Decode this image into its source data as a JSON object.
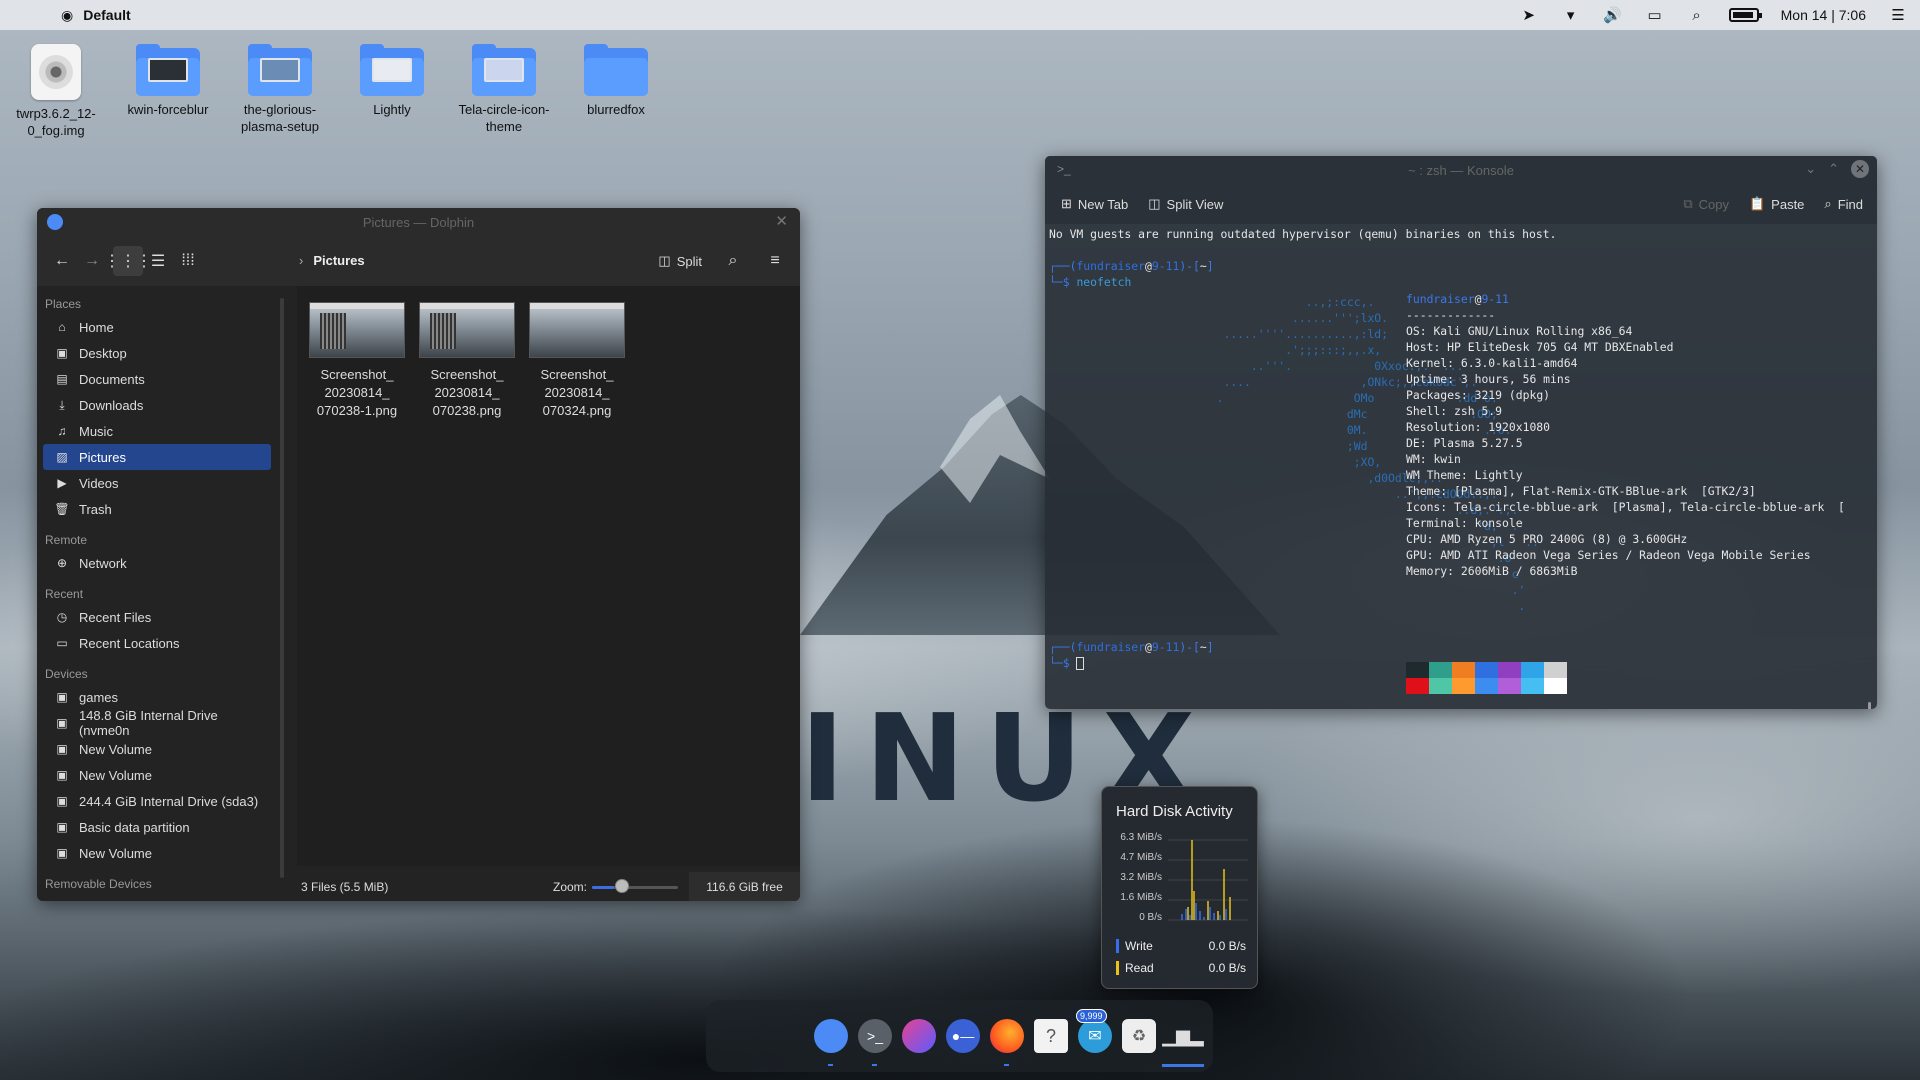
{
  "topbar": {
    "app": "Default",
    "clock": "Mon 14 | 7:06"
  },
  "desktop_icons": [
    {
      "label": "twrp3.6.2_12-0_fog.img",
      "type": "disc"
    },
    {
      "label": "kwin-forceblur",
      "type": "folder"
    },
    {
      "label": "the-glorious-plasma-setup",
      "type": "folder"
    },
    {
      "label": "Lightly",
      "type": "folder"
    },
    {
      "label": "Tela-circle-icon-theme",
      "type": "folder"
    },
    {
      "label": "blurredfox",
      "type": "folder"
    }
  ],
  "wallpaper_text": "INUX",
  "dolphin": {
    "title": "Pictures — Dolphin",
    "crumb": "Pictures",
    "split_label": "Split",
    "sidebar": {
      "places_head": "Places",
      "places": [
        "Home",
        "Desktop",
        "Documents",
        "Downloads",
        "Music",
        "Pictures",
        "Videos",
        "Trash"
      ],
      "remote_head": "Remote",
      "remote": [
        "Network"
      ],
      "recent_head": "Recent",
      "recent": [
        "Recent Files",
        "Recent Locations"
      ],
      "devices_head": "Devices",
      "devices": [
        "games",
        "148.8 GiB Internal Drive (nvme0n",
        "New Volume",
        "New Volume",
        "244.4 GiB Internal Drive (sda3)",
        "Basic data partition",
        "New Volume"
      ],
      "removable_head": "Removable Devices"
    },
    "files": [
      {
        "l1": "Screenshot_",
        "l2": "20230814_",
        "l3": "070238-1.png"
      },
      {
        "l1": "Screenshot_",
        "l2": "20230814_",
        "l3": "070238.png"
      },
      {
        "l1": "Screenshot_",
        "l2": "20230814_",
        "l3": "070324.png"
      }
    ],
    "status": "3 Files (5.5 MiB)",
    "zoom_label": "Zoom:",
    "zoom_level": 0.25,
    "free": "116.6 GiB free"
  },
  "konsole": {
    "title": "~ : zsh — Konsole",
    "new_tab": "New Tab",
    "split_view": "Split View",
    "copy": "Copy",
    "paste": "Paste",
    "find": "Find",
    "line1": "No VM guests are running outdated hypervisor (qemu) binaries on this host.",
    "user": "fundraiser",
    "host": "9-11",
    "path": "~",
    "command": "neofetch",
    "separator": "-------------",
    "info": [
      {
        "k": "OS",
        "v": "Kali GNU/Linux Rolling x86_64"
      },
      {
        "k": "Host",
        "v": "HP EliteDesk 705 G4 MT DBXEnabled"
      },
      {
        "k": "Kernel",
        "v": "6.3.0-kali1-amd64"
      },
      {
        "k": "Uptime",
        "v": "3 hours, 56 mins"
      },
      {
        "k": "Packages",
        "v": "3219 (dpkg)"
      },
      {
        "k": "Shell",
        "v": "zsh 5.9"
      },
      {
        "k": "Resolution",
        "v": "1920x1080"
      },
      {
        "k": "DE",
        "v": "Plasma 5.27.5"
      },
      {
        "k": "WM",
        "v": "kwin"
      },
      {
        "k": "WM Theme",
        "v": "Lightly"
      },
      {
        "k": "Theme",
        "v": "[Plasma], Flat-Remix-GTK-BBlue-ark  [GTK2/3]"
      },
      {
        "k": "Icons",
        "v": "Tela-circle-bblue-ark  [Plasma], Tela-circle-bblue-ark  ["
      },
      {
        "k": "Terminal",
        "v": "konsole"
      },
      {
        "k": "CPU",
        "v": "AMD Ryzen 5 PRO 2400G (8) @ 3.600GHz"
      },
      {
        "k": "GPU",
        "v": "AMD ATI Radeon Vega Series / Radeon Vega Mobile Series"
      },
      {
        "k": "Memory",
        "v": "2606MiB / 6863MiB"
      }
    ],
    "swatches": [
      "#1e2a2e",
      "#e0101a",
      "#2f9e8a",
      "#4fc6a5",
      "#ef7d22",
      "#ff9a2e",
      "#2f6fe0",
      "#3d8cf0",
      "#8f3fbf",
      "#b05fd8",
      "#2fa4e8",
      "#45bff2",
      "#d0d0d0",
      "#ffffff"
    ]
  },
  "hdd": {
    "title": "Hard Disk Activity",
    "yticks": [
      "6.3 MiB/s",
      "4.7 MiB/s",
      "3.2 MiB/s",
      "1.6 MiB/s",
      "0 B/s"
    ],
    "write_label": "Write",
    "write_value": "0.0 B/s",
    "write_color": "#3a6ee8",
    "read_label": "Read",
    "read_value": "0.0 B/s",
    "read_color": "#e8c21a"
  },
  "dock": {
    "badge": "9,999",
    "items": [
      "apple-icon",
      "apple-icon",
      "folder-icon",
      "terminal-icon",
      "browser-icon",
      "toggle-icon",
      "firefox-icon",
      "help-icon",
      "mail-icon",
      "recycle-icon",
      "activity-icon"
    ]
  }
}
